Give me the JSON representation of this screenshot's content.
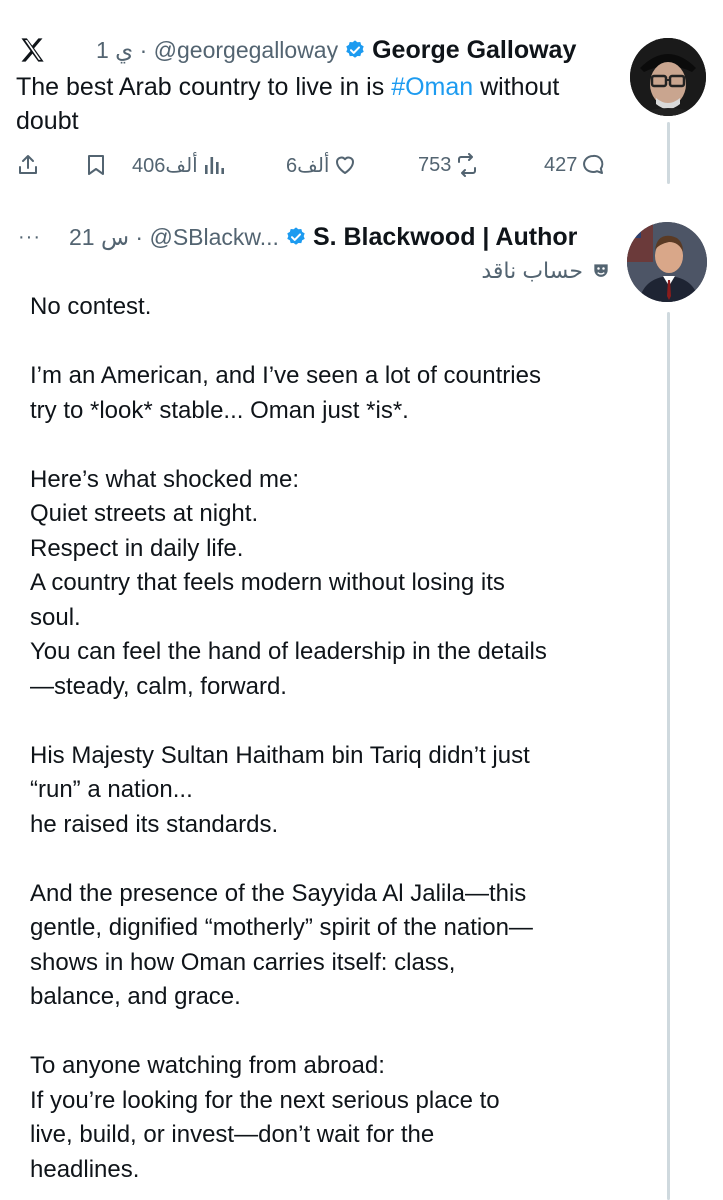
{
  "tweet1": {
    "display_name": "George Galloway",
    "handle_time": "ي 1 · @georgegalloway",
    "text_before": "The best Arab country to live in is ",
    "hashtag": "#Oman",
    "text_after": " without doubt",
    "replies": "427",
    "reposts": "753",
    "likes": "6ألف",
    "views": "406ألف"
  },
  "tweet2": {
    "display_name": "S. Blackwood | Author",
    "handle_time": "س 21 · @SBlackw...",
    "more": "···",
    "critic_label": "حساب ناقد",
    "lines": [
      "No contest.",
      "",
      "I’m an American, and I’ve seen a lot of countries",
      "try to *look* stable... Oman just *is*.",
      "",
      "Here’s what shocked me:",
      "Quiet streets at night.",
      "Respect in daily life.",
      "A country that feels modern without losing its",
      "soul.",
      "You can feel the hand of leadership in the details",
      "—steady, calm, forward.",
      "",
      "His Majesty Sultan Haitham bin Tariq didn’t just",
      "“run” a nation...",
      "he raised its standards.",
      "",
      "And the presence of the Sayyida Al Jalila—this",
      "gentle, dignified “motherly” spirit of the nation—",
      "shows in how Oman carries itself: class,",
      "balance, and grace.",
      "",
      "To anyone watching from abroad:",
      "If you’re looking for the next serious place to",
      "live, build, or invest—don’t wait for the",
      "headlines."
    ]
  },
  "icons": {
    "x_logo": "x-logo-icon",
    "verified": "verified-badge-icon",
    "reply": "reply-icon",
    "repost": "repost-icon",
    "like": "heart-icon",
    "views": "views-icon",
    "bookmark": "bookmark-icon",
    "share": "share-icon",
    "critic": "theater-mask-icon"
  },
  "colors": {
    "link": "#1d9bf0",
    "verified": "#1d9bf0",
    "secondary_text": "#536471",
    "thread_line": "#cfd9de"
  }
}
